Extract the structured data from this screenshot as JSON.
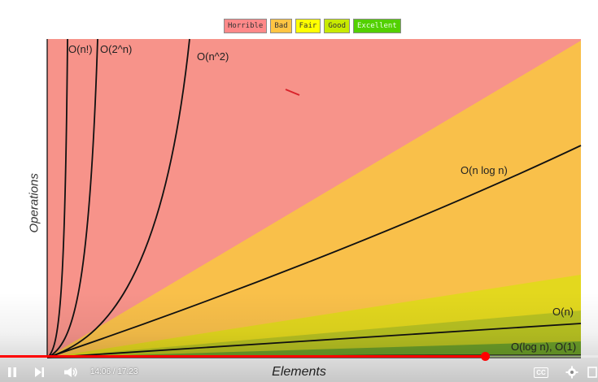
{
  "legend": [
    {
      "label": "Horrible",
      "color": "#ff8989"
    },
    {
      "label": "Bad",
      "color": "#ffc543"
    },
    {
      "label": "Fair",
      "color": "#ffff00"
    },
    {
      "label": "Good",
      "color": "#c8ea00"
    },
    {
      "label": "Excellent",
      "color": "#53d000"
    }
  ],
  "axes": {
    "ylabel": "Operations",
    "xlabel": "Elements"
  },
  "curve_labels": {
    "factorial": "O(n!)",
    "exponential": "O(2^n)",
    "quadratic": "O(n^2)",
    "nlogn": "O(n log n)",
    "linear": "O(n)",
    "log_const": "O(log n), O(1)"
  },
  "colors": {
    "horrible": "#f7938a",
    "bad": "#f9c04a",
    "fair": "#e3d81e",
    "good": "#b9c322",
    "excellent": "#6da029",
    "progress": "#ff0000"
  },
  "player": {
    "time": "14:06 / 17:23",
    "progress": 0.811,
    "icons": [
      "pause-icon",
      "next-icon",
      "volume-icon",
      "cc-icon",
      "gear-icon",
      "miniplayer-icon"
    ],
    "cc_label": "CC"
  }
}
